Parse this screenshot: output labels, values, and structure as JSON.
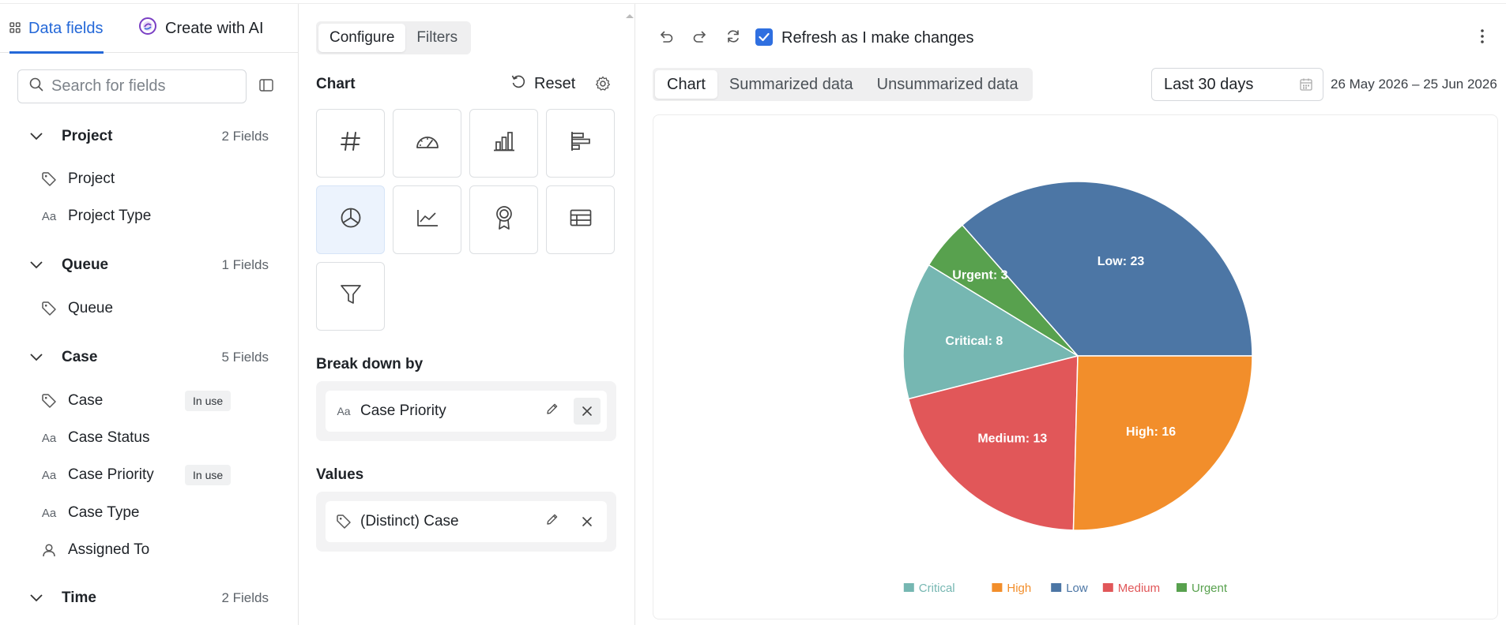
{
  "left_panel": {
    "tabs": [
      {
        "label": "Data fields",
        "icon": "grid-icon",
        "active": true
      },
      {
        "label": "Create with AI",
        "icon": "ai-sparkle-icon",
        "active": false
      }
    ],
    "search": {
      "placeholder": "Search for fields",
      "value": ""
    },
    "groups": [
      {
        "name": "Project",
        "count": "2 Fields",
        "fields": [
          {
            "label": "Project",
            "icon": "tag-icon"
          },
          {
            "label": "Project Type",
            "icon": "text-type-icon"
          }
        ]
      },
      {
        "name": "Queue",
        "count": "1 Fields",
        "fields": [
          {
            "label": "Queue",
            "icon": "tag-icon"
          }
        ]
      },
      {
        "name": "Case",
        "count": "5 Fields",
        "fields": [
          {
            "label": "Case",
            "icon": "tag-icon",
            "badge": "In use"
          },
          {
            "label": "Case Status",
            "icon": "text-type-icon"
          },
          {
            "label": "Case Priority",
            "icon": "text-type-icon",
            "badge": "In use"
          },
          {
            "label": "Case Type",
            "icon": "text-type-icon"
          },
          {
            "label": "Assigned To",
            "icon": "user-icon"
          }
        ]
      },
      {
        "name": "Time",
        "count": "2 Fields",
        "fields": []
      }
    ],
    "text_type_glyph": "Aa"
  },
  "config_panel": {
    "tabs": [
      "Configure",
      "Filters"
    ],
    "active_tab": "Configure",
    "chart_section_title": "Chart",
    "reset_label": "Reset",
    "chart_types": [
      {
        "icon": "number-icon",
        "selected": false
      },
      {
        "icon": "gauge-icon",
        "selected": false
      },
      {
        "icon": "bar-chart-icon",
        "selected": false
      },
      {
        "icon": "horizontal-bar-icon",
        "selected": false
      },
      {
        "icon": "pie-chart-icon",
        "selected": true
      },
      {
        "icon": "line-chart-icon",
        "selected": false
      },
      {
        "icon": "award-icon",
        "selected": false
      },
      {
        "icon": "table-icon",
        "selected": false
      },
      {
        "icon": "funnel-icon",
        "selected": false
      }
    ],
    "breakdown": {
      "title": "Break down by",
      "field": "Case Priority",
      "icon": "text-type-icon"
    },
    "values": {
      "title": "Values",
      "field": "(Distinct) Case",
      "icon": "tag-icon"
    }
  },
  "toolbar": {
    "refresh_label": "Refresh as I make changes",
    "refresh_checked": true
  },
  "view_tabs": {
    "items": [
      "Chart",
      "Summarized data",
      "Unsummarized data"
    ],
    "active": "Chart"
  },
  "date_filter": {
    "value": "Last 30 days",
    "range_text": "26 May 2026 – 25 Jun 2026"
  },
  "chart_data": {
    "type": "pie",
    "slices": [
      {
        "label": "Low",
        "value": 23,
        "color": "#4c76a5"
      },
      {
        "label": "Urgent",
        "value": 3,
        "color": "#58a14e"
      },
      {
        "label": "Critical",
        "value": 8,
        "color": "#76b7b2"
      },
      {
        "label": "Medium",
        "value": 13,
        "color": "#e15759"
      },
      {
        "label": "High",
        "value": 16,
        "color": "#f28e2b"
      }
    ],
    "legend": [
      "Critical",
      "High",
      "Low",
      "Medium",
      "Urgent"
    ],
    "legend_position": "bottom",
    "data_labels": true
  }
}
